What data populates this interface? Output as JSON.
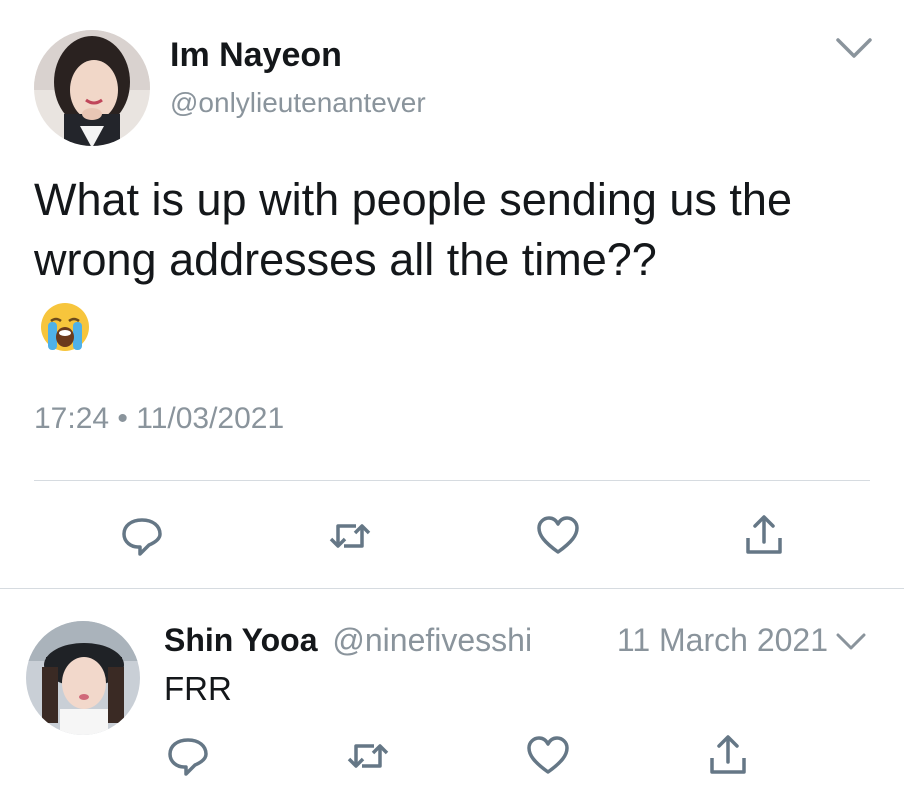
{
  "tweet": {
    "author_name": "Im Nayeon",
    "author_handle": "@onlylieutenantever",
    "text": "What is up with people sending us the wrong addresses all the time??",
    "emoji": "loudly-crying-face-emoji",
    "timestamp": "17:24 • 11/03/2021",
    "actions": [
      "reply-icon",
      "retweet-icon",
      "like-icon",
      "share-icon"
    ]
  },
  "reply": {
    "author_name": "Shin Yooa",
    "author_handle": "@ninefivesshi",
    "date": "11 March 2021",
    "text": "FRR",
    "actions": [
      "reply-icon",
      "retweet-icon",
      "like-icon",
      "share-icon"
    ]
  },
  "colors": {
    "text": "#14171a",
    "secondary": "#8a949c",
    "icon": "#657786",
    "divider": "#d6dbe0"
  }
}
